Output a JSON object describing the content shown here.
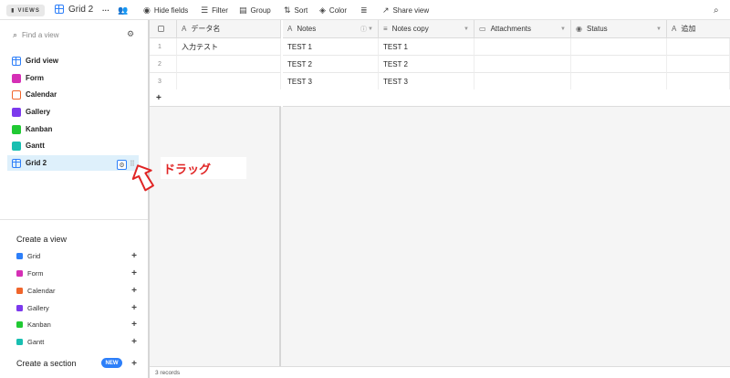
{
  "toolbar": {
    "views_label": "VIEWS",
    "view_name": "Grid 2",
    "more": "···",
    "hide_fields": "Hide fields",
    "filter": "Filter",
    "group": "Group",
    "sort": "Sort",
    "color": "Color",
    "share_view": "Share view",
    "icons": [
      "sidebar-toggle-icon",
      "grid-view-icon",
      "more-icon",
      "collaborators-icon",
      "eye-icon",
      "filter-icon",
      "group-icon",
      "sort-icon",
      "color-icon",
      "row-height-icon",
      "share-icon",
      "search-icon"
    ]
  },
  "sidebar": {
    "search_placeholder": "Find a view",
    "views": [
      {
        "label": "Grid view",
        "icon": "grid-icon"
      },
      {
        "label": "Form",
        "icon": "form-icon"
      },
      {
        "label": "Calendar",
        "icon": "calendar-icon"
      },
      {
        "label": "Gallery",
        "icon": "gallery-icon"
      },
      {
        "label": "Kanban",
        "icon": "kanban-icon"
      },
      {
        "label": "Gantt",
        "icon": "gantt-icon"
      },
      {
        "label": "Grid 2",
        "icon": "grid-icon",
        "active": true
      }
    ],
    "create_title": "Create a view",
    "create_items": [
      {
        "label": "Grid",
        "color": "#2d7ff9"
      },
      {
        "label": "Form",
        "color": "#d52fb5"
      },
      {
        "label": "Calendar",
        "color": "#f0652b"
      },
      {
        "label": "Gallery",
        "color": "#7c39ed"
      },
      {
        "label": "Kanban",
        "color": "#20c933"
      },
      {
        "label": "Gantt",
        "color": "#18bfb1"
      }
    ],
    "create_section": "Create a section",
    "new_badge": "NEW",
    "plus": "+"
  },
  "annotation": {
    "label": "ドラッグ",
    "color": "#e02424"
  },
  "grid": {
    "columns": [
      "データ名",
      "Notes",
      "Notes copy",
      "Attachments",
      "Status",
      "追加"
    ],
    "rows": [
      {
        "num": "1",
        "name": "入力テスト",
        "notes": "TEST 1",
        "notes_copy": "TEST 1"
      },
      {
        "num": "2",
        "name": "",
        "notes": "TEST 2",
        "notes_copy": "TEST 2"
      },
      {
        "num": "3",
        "name": "",
        "notes": "TEST 3",
        "notes_copy": "TEST 3"
      }
    ],
    "add_row": "+",
    "footer": "3 records"
  },
  "colors": {
    "accent": "#2d7ff9",
    "active_bg": "#def0fb",
    "annotation_red": "#e02424"
  }
}
